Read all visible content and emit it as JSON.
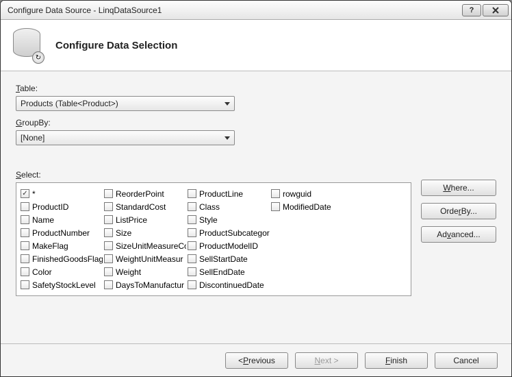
{
  "window": {
    "title": "Configure Data Source - LinqDataSource1"
  },
  "header": {
    "title": "Configure Data Selection"
  },
  "table": {
    "label_pre": "T",
    "label_rest": "able:",
    "value": "Products (Table<Product>)"
  },
  "groupby": {
    "label_pre": "G",
    "label_rest": "roupBy:",
    "value": "[None]"
  },
  "select": {
    "label_pre": "S",
    "label_rest": "elect:",
    "columns": [
      [
        "*",
        "ProductID",
        "Name",
        "ProductNumber",
        "MakeFlag",
        "FinishedGoodsFlag",
        "Color",
        "SafetyStockLevel"
      ],
      [
        "ReorderPoint",
        "StandardCost",
        "ListPrice",
        "Size",
        "SizeUnitMeasureCo",
        "WeightUnitMeasur",
        "Weight",
        "DaysToManufactur"
      ],
      [
        "ProductLine",
        "Class",
        "Style",
        "ProductSubcategor",
        "ProductModelID",
        "SellStartDate",
        "SellEndDate",
        "DiscontinuedDate"
      ],
      [
        "rowguid",
        "ModifiedDate"
      ]
    ],
    "checked": [
      "*"
    ]
  },
  "sidebuttons": {
    "where_pre": "W",
    "where_rest": "here...",
    "orderby_label": "OrderBy...",
    "advanced_label": "Advanced..."
  },
  "footer": {
    "previous_pre": "< ",
    "previous_u": "P",
    "previous_rest": "revious",
    "next_u": "N",
    "next_rest": "ext >",
    "finish_u": "F",
    "finish_rest": "inish",
    "cancel": "Cancel"
  }
}
